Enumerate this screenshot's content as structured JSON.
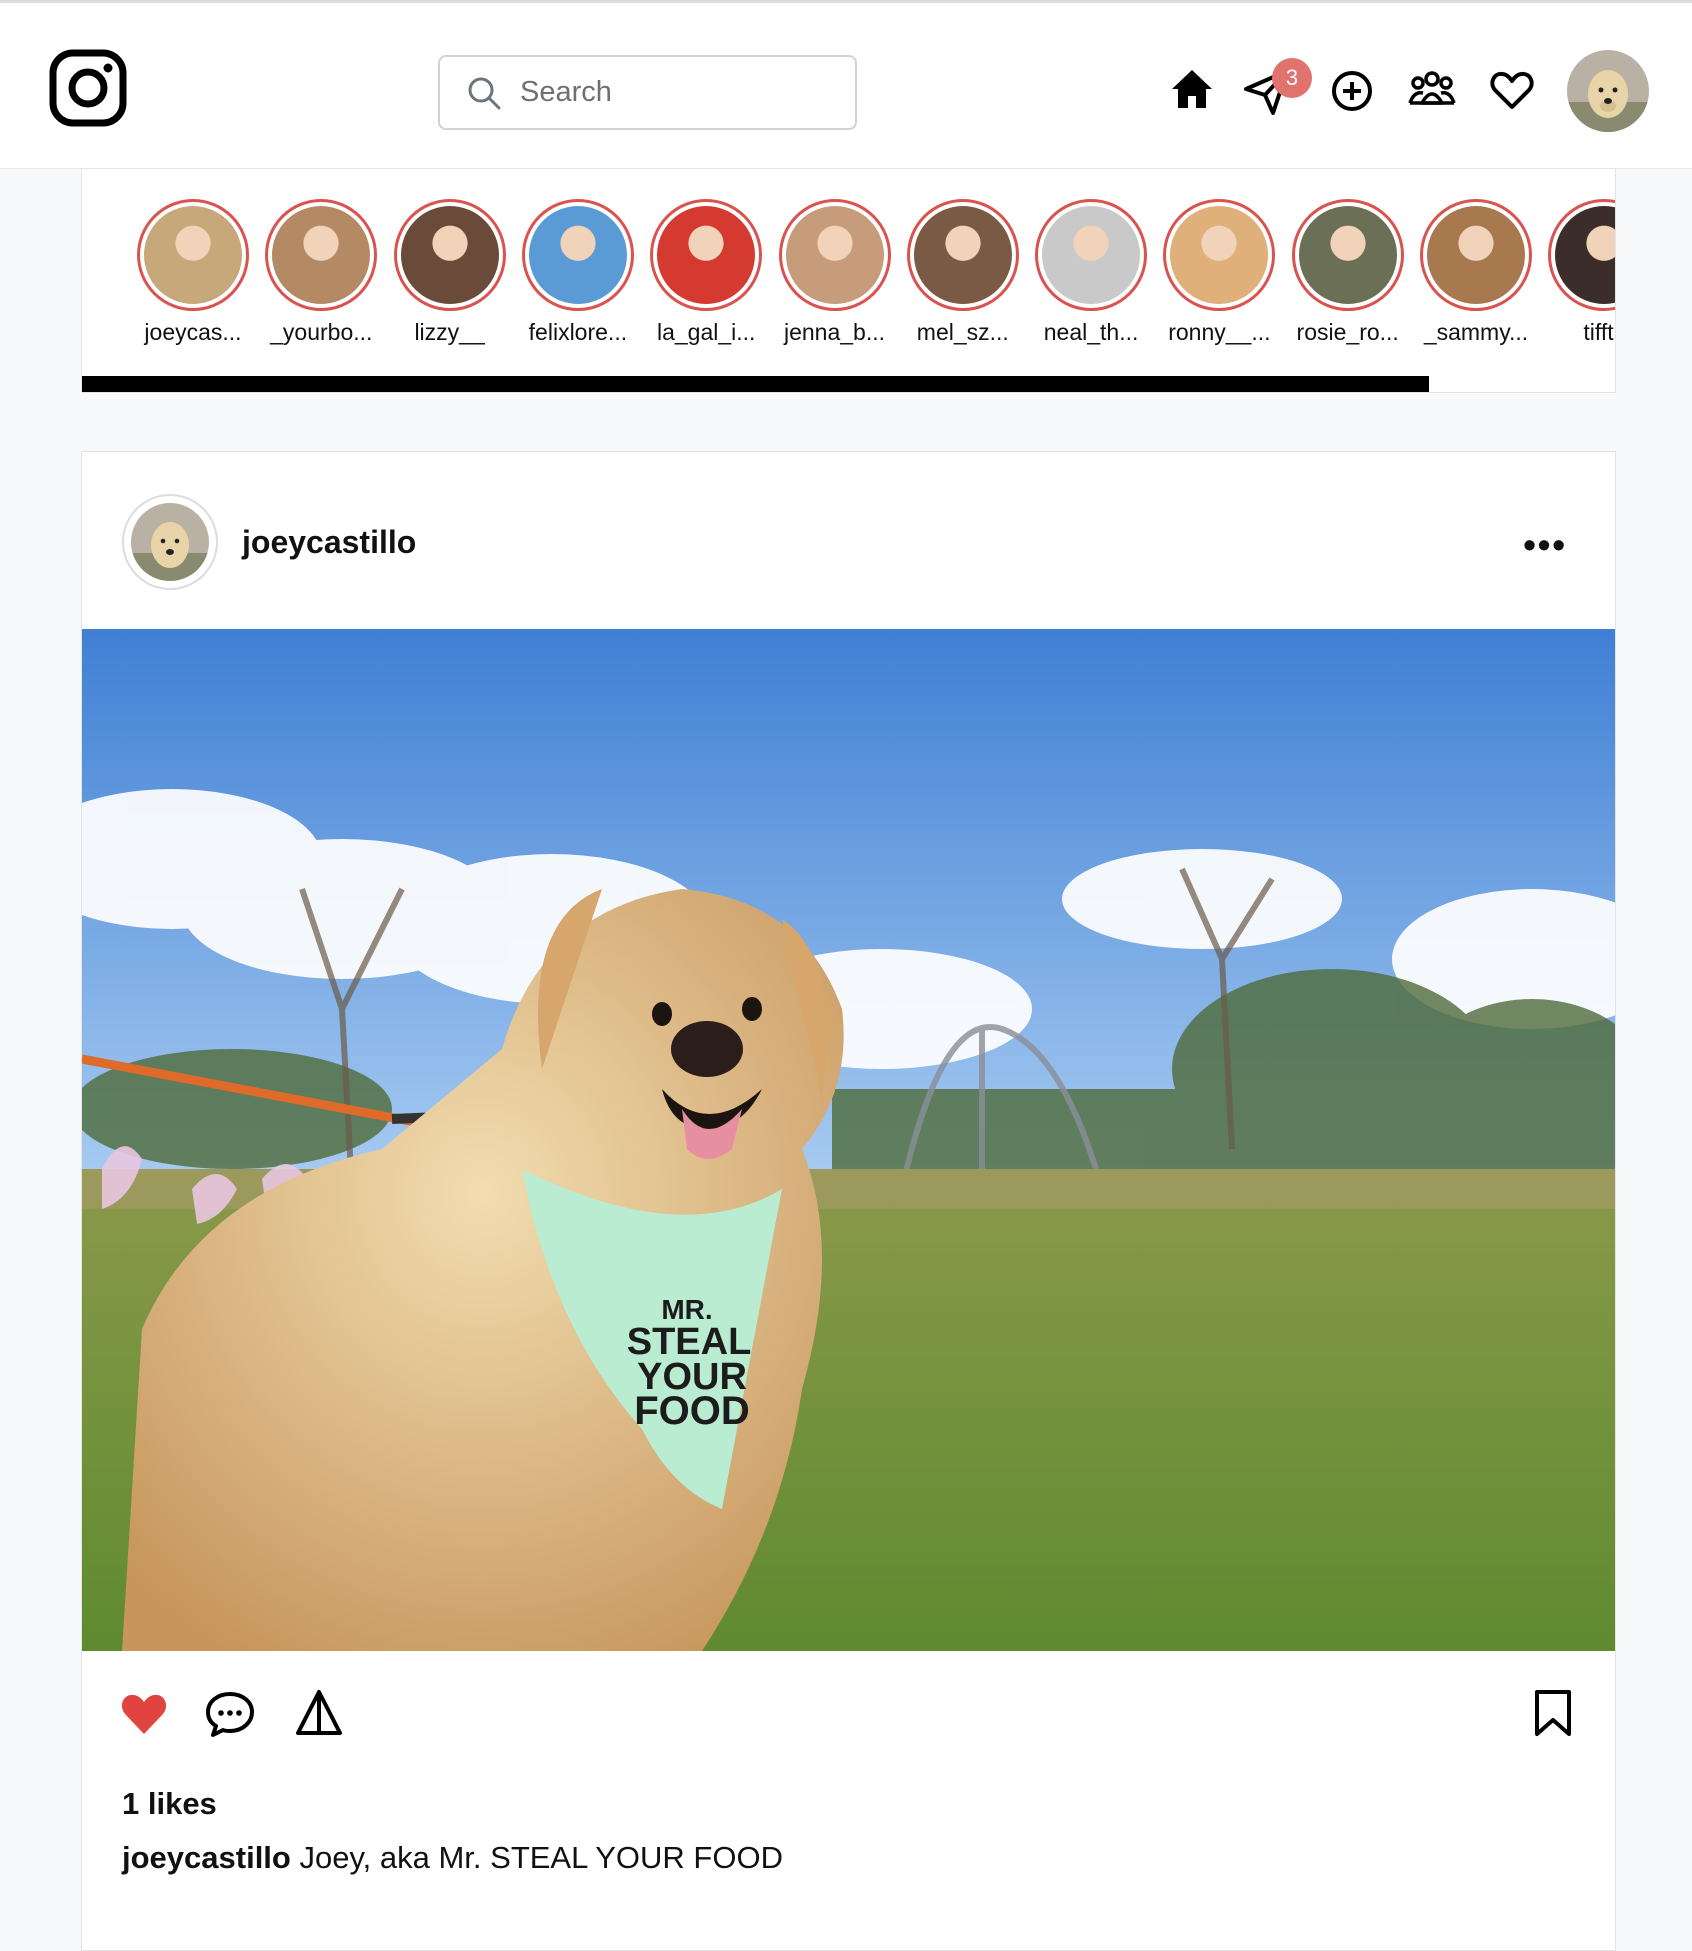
{
  "search": {
    "placeholder": "Search"
  },
  "nav": {
    "messages_badge": "3"
  },
  "stories": [
    {
      "name": "joeycas...",
      "hue": "#c7a87a"
    },
    {
      "name": "_yourbo...",
      "hue": "#b48a64"
    },
    {
      "name": "lizzy__",
      "hue": "#6a4a38"
    },
    {
      "name": "felixlore...",
      "hue": "#5b9bd5"
    },
    {
      "name": "la_gal_i...",
      "hue": "#d43a2f"
    },
    {
      "name": "jenna_b...",
      "hue": "#c69c7a"
    },
    {
      "name": "mel_sz...",
      "hue": "#7a5a44"
    },
    {
      "name": "neal_th...",
      "hue": "#c9c9c9"
    },
    {
      "name": "ronny__...",
      "hue": "#e0b07a"
    },
    {
      "name": "rosie_ro...",
      "hue": "#6b6f55"
    },
    {
      "name": "_sammy...",
      "hue": "#a8794f"
    },
    {
      "name": "tifftif",
      "hue": "#3a2d2a"
    }
  ],
  "post": {
    "username": "joeycastillo",
    "more_label": "•••",
    "likes": "1 likes",
    "caption_user": "joeycastillo",
    "caption_text": "Joey, aka Mr. STEAL YOUR FOOD",
    "photo_bandana_text": [
      "MR.",
      "STEAL",
      "YOUR",
      "FOOD"
    ]
  },
  "colors": {
    "story_ring": "#d9534f",
    "like_active": "#e0443e",
    "badge": "#e0736e"
  }
}
